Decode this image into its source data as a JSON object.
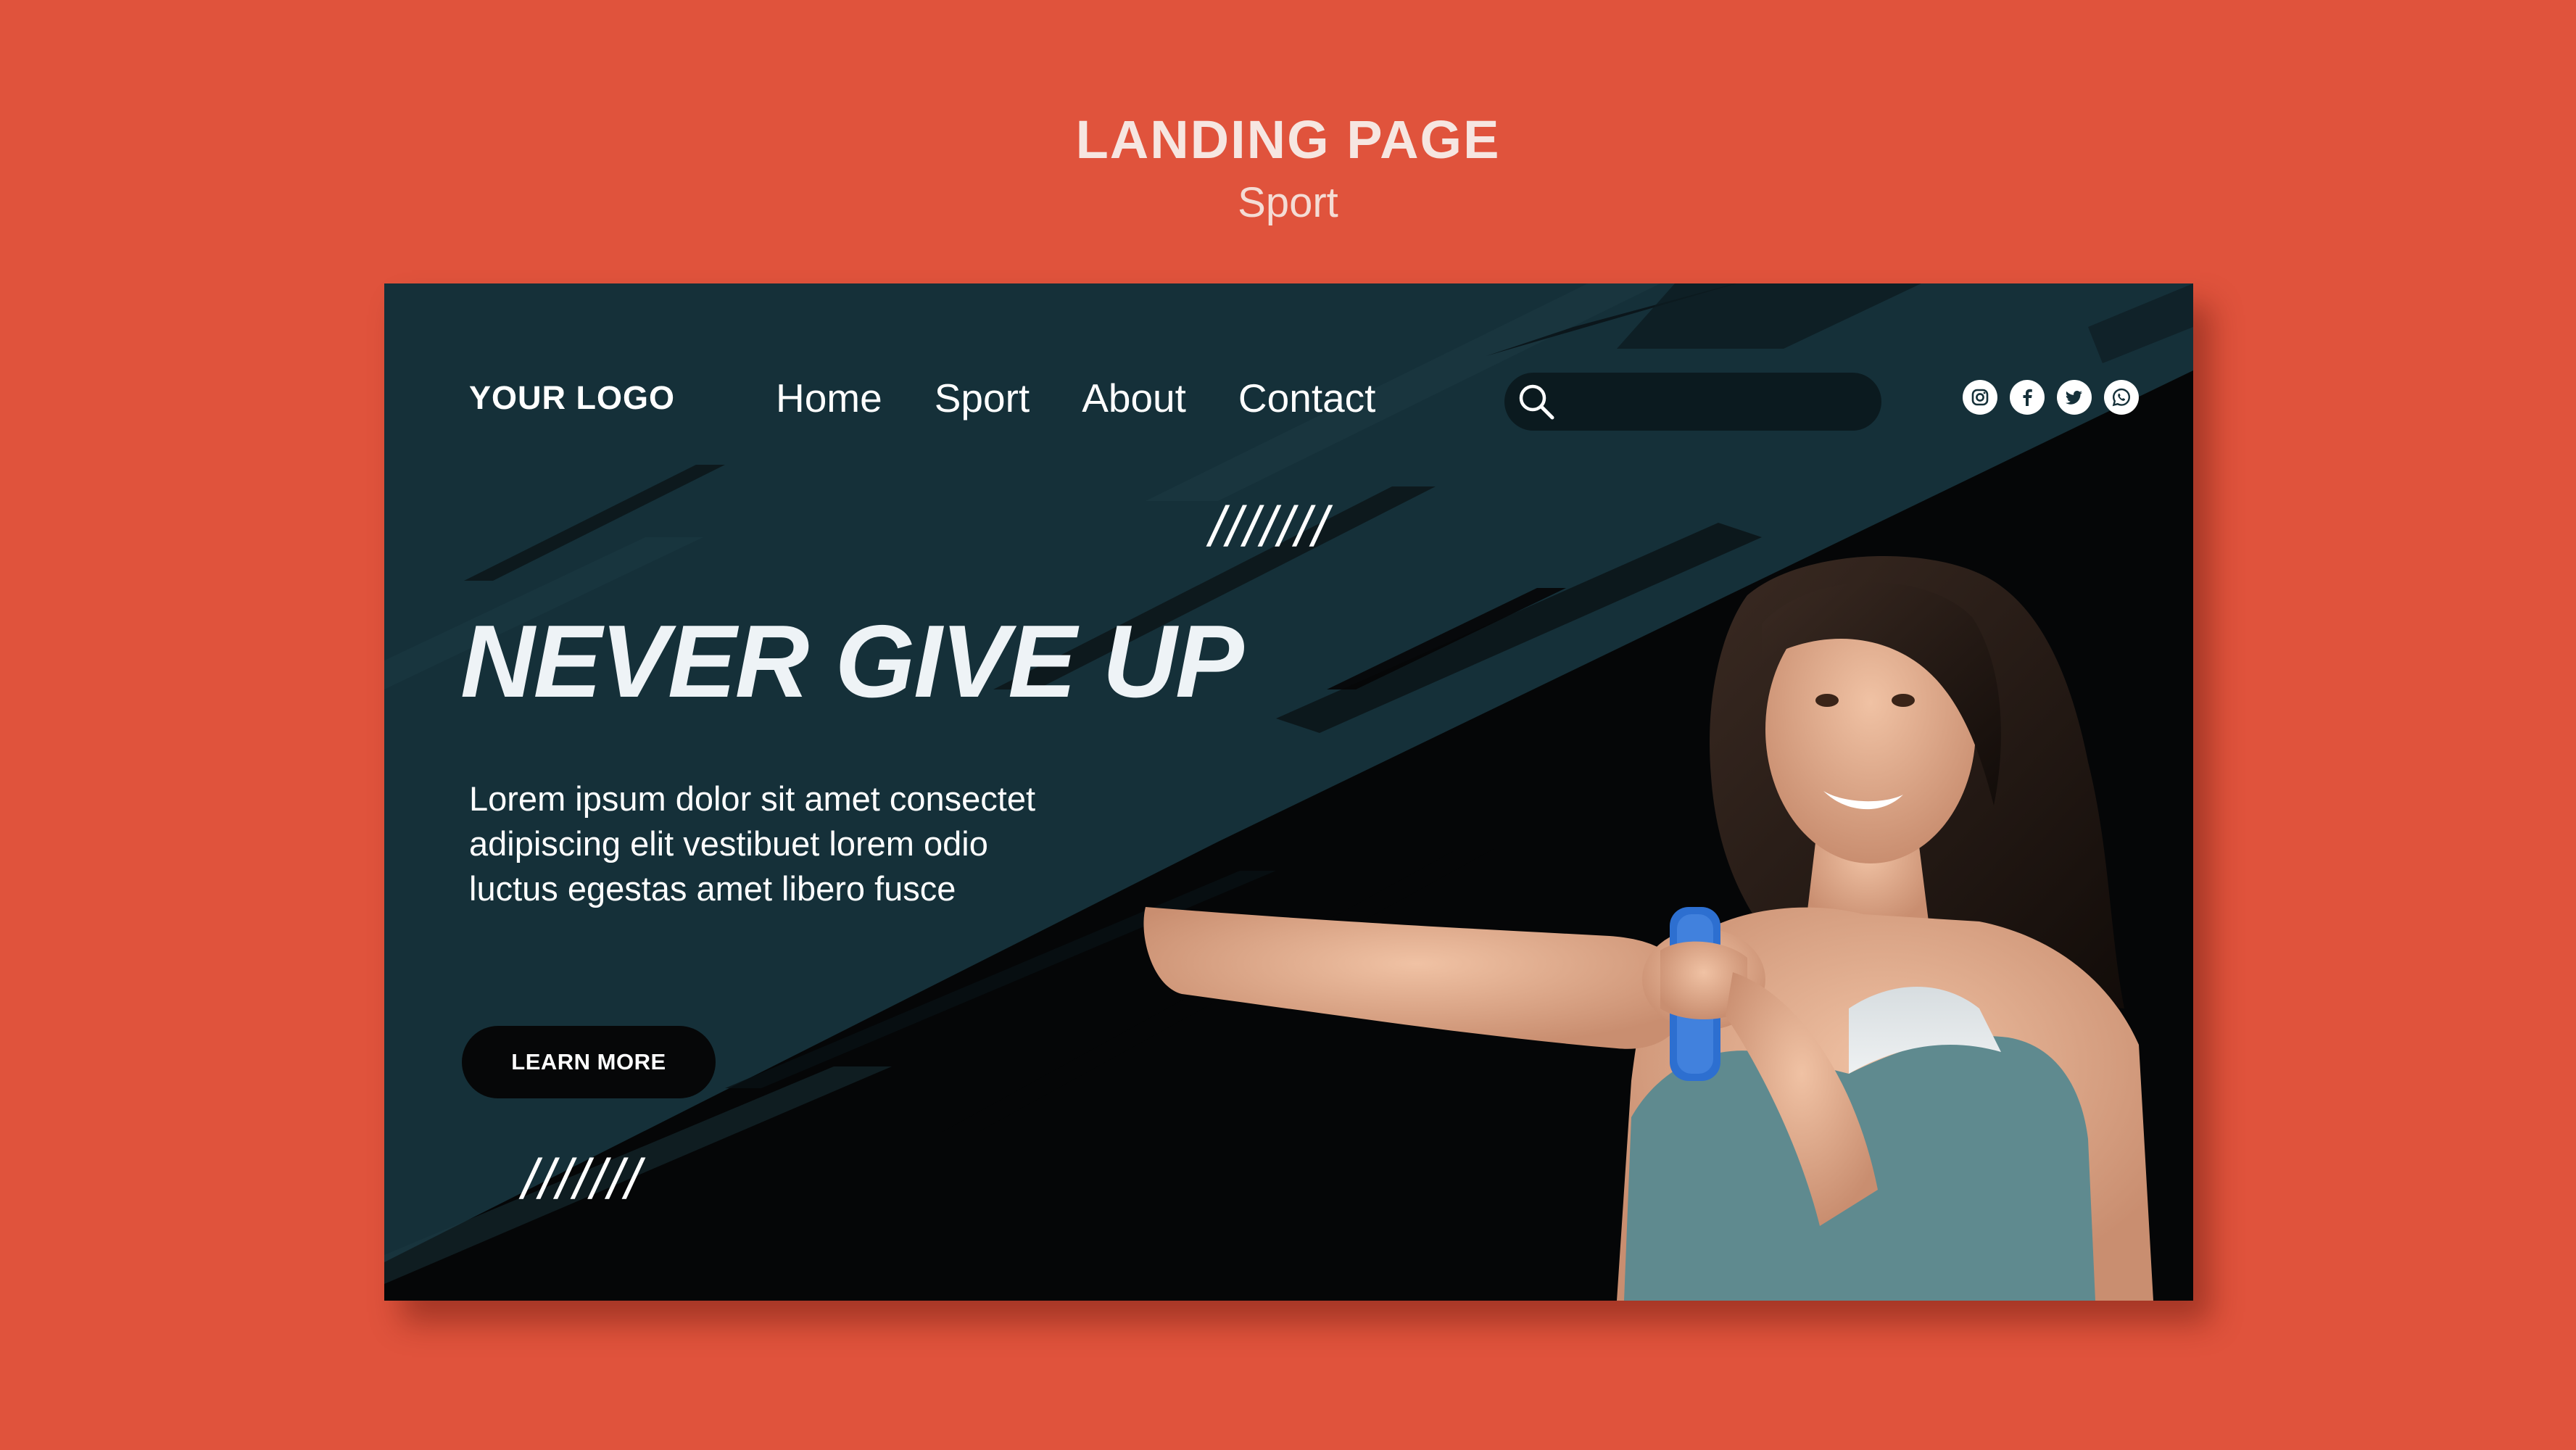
{
  "frame": {
    "title": "LANDING PAGE",
    "subtitle": "Sport"
  },
  "header": {
    "logo": "YOUR LOGO",
    "nav": [
      {
        "label": "Home"
      },
      {
        "label": "Sport"
      },
      {
        "label": "About"
      },
      {
        "label": "Contact"
      }
    ],
    "search": {
      "value": "",
      "icon": "search-icon"
    },
    "socials": [
      {
        "name": "instagram-icon"
      },
      {
        "name": "facebook-icon"
      },
      {
        "name": "twitter-icon"
      },
      {
        "name": "whatsapp-icon"
      }
    ]
  },
  "hero": {
    "decor_slashes": "///////",
    "headline": "NEVER GIVE UP",
    "body_lines": [
      "Lorem ipsum dolor sit amet consectet",
      "adipiscing elit vestibuet lorem odio",
      "luctus egestas amet libero fusce"
    ],
    "cta_label": "LEARN MORE"
  },
  "colors": {
    "page_background": "#e0533c",
    "panel_teal": "#153039",
    "panel_dark": "#050607",
    "cta_background": "#060708",
    "dumbbell_blue": "#2d6fd0"
  }
}
